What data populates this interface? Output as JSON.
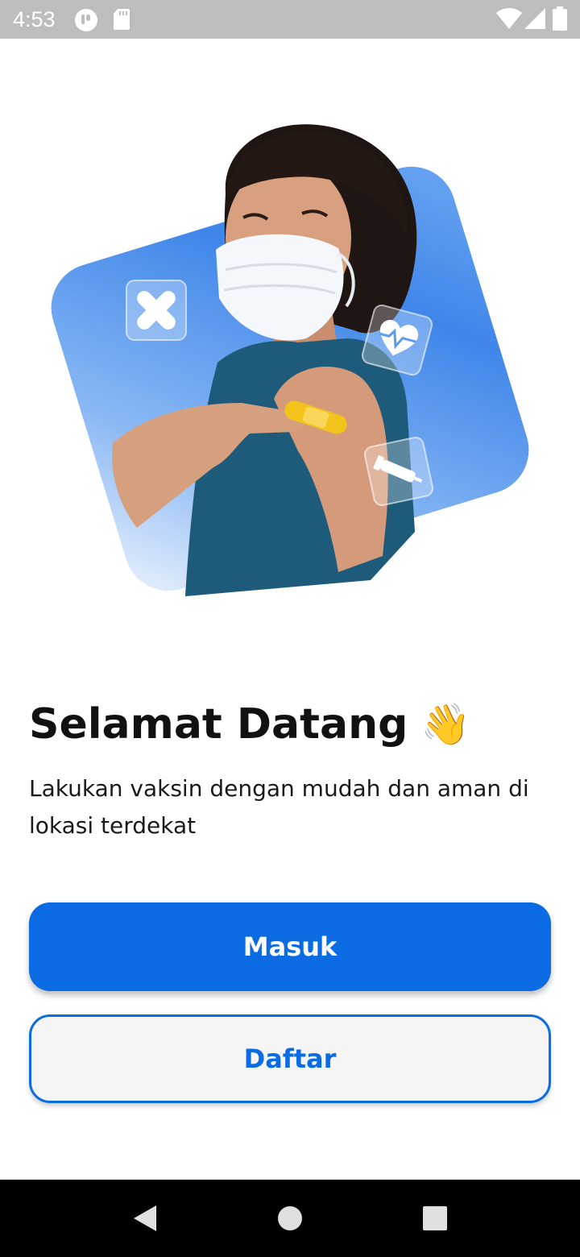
{
  "status_bar": {
    "time": "4:53",
    "icons": [
      "notification-app-icon",
      "sd-card-icon",
      "wifi-icon",
      "signal-icon",
      "battery-icon"
    ]
  },
  "hero": {
    "image": "woman-with-mask-showing-vaccine-bandage-illustration",
    "card_color": "#5b9bf0",
    "badges": [
      "bandage-icon",
      "heart-pulse-icon",
      "vaccine-syringe-icon"
    ]
  },
  "welcome": {
    "title": "Selamat Datang",
    "emoji": "👋",
    "subtitle": "Lakukan vaksin dengan mudah dan aman di lokasi terdekat"
  },
  "actions": {
    "login_label": "Masuk",
    "register_label": "Daftar"
  },
  "nav_bar": {
    "buttons": [
      "back-icon",
      "home-icon",
      "recents-icon"
    ]
  },
  "colors": {
    "primary": "#0a6be3",
    "status_bar": "#bdbdbd",
    "nav_bar": "#000000",
    "background": "#ffffff"
  }
}
